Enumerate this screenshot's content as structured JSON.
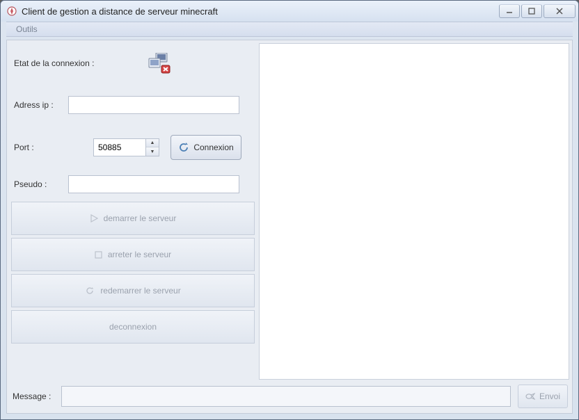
{
  "window": {
    "title": "Client de gestion a distance de serveur minecraft"
  },
  "menubar": {
    "tools": "Outils"
  },
  "labels": {
    "connection_state": "Etat de la connexion :",
    "ip": "Adress ip :",
    "port": "Port :",
    "pseudo": "Pseudo :",
    "message": "Message :"
  },
  "inputs": {
    "ip": "",
    "port": "50885",
    "pseudo": "",
    "message": ""
  },
  "buttons": {
    "connect": "Connexion",
    "start_server": "demarrer le serveur",
    "stop_server": "arreter le serveur",
    "restart_server": "redemarrer le serveur",
    "disconnect": "deconnexion",
    "send": "Envoi"
  }
}
